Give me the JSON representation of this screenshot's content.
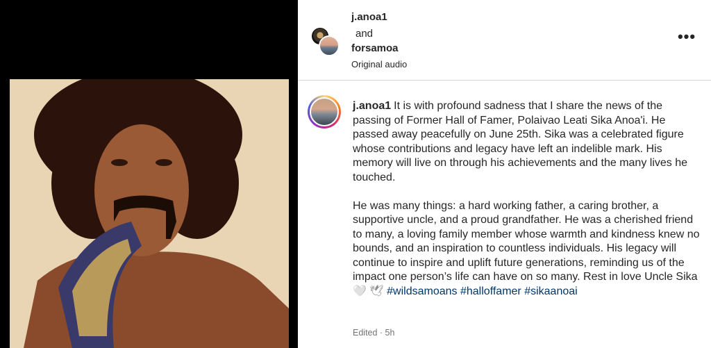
{
  "post": {
    "owners": [
      "j.anoa1",
      "forsamoa"
    ],
    "joiner": "and",
    "audio_label": "Original audio",
    "more_label": "•••"
  },
  "caption": {
    "username": "j.anoa1",
    "paragraph1": "It is with profound sadness that I share the news of the passing of Former Hall of Famer, Polaivao Leati Sika Anoa'i. He passed away peacefully on June 25th. Sika was a celebrated figure whose contributions and legacy have left an indelible mark. His memory will live on through his achievements and the many lives he touched.",
    "paragraph2": "He was many things: a hard working father, a caring brother, a supportive uncle, and a proud grandfather. He was a cherished friend to many, a loving family member whose warmth and kindness knew no bounds, and an inspiration to countless individuals. His legacy will continue to inspire and uplift future generations, reminding us of the impact one person’s life can have on so many. Rest in love Uncle Sika",
    "emoji": "🤍 🕊",
    "hashtags": [
      "#wildsamoans",
      "#halloffamer",
      "#sikaanoai"
    ],
    "edited": "Edited · 5h"
  },
  "colors": {
    "link": "#00376b",
    "text": "#262626",
    "muted": "#737373"
  }
}
